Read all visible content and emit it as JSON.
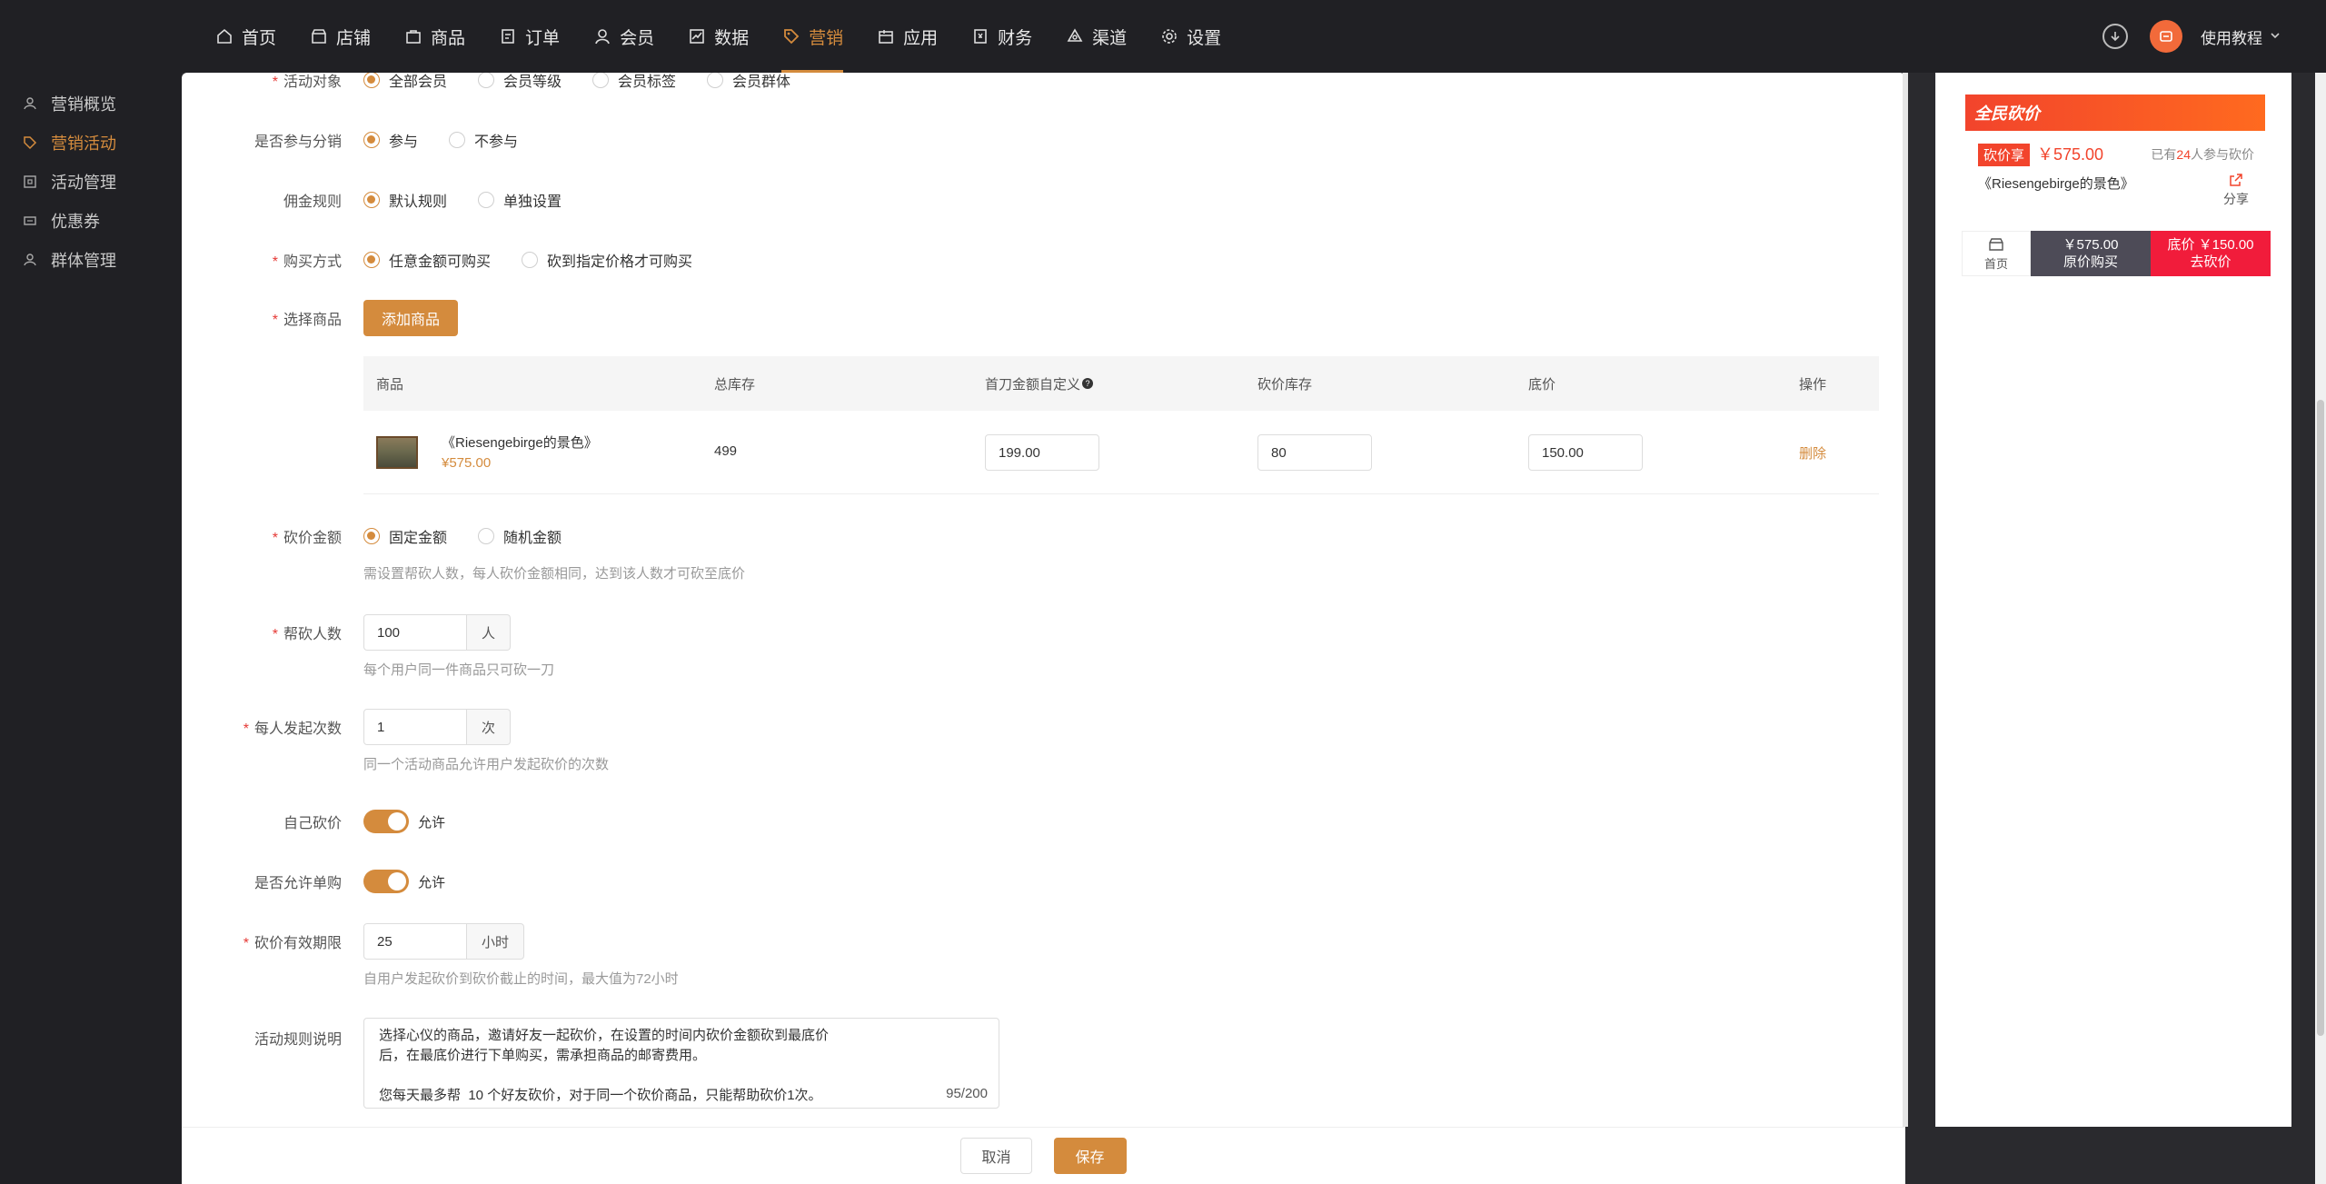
{
  "nav": {
    "items": [
      {
        "label": "首页",
        "icon": "home-icon"
      },
      {
        "label": "店铺",
        "icon": "store-icon"
      },
      {
        "label": "商品",
        "icon": "bag-icon"
      },
      {
        "label": "订单",
        "icon": "order-icon"
      },
      {
        "label": "会员",
        "icon": "user-icon"
      },
      {
        "label": "数据",
        "icon": "chart-icon"
      },
      {
        "label": "营销",
        "icon": "tag-icon"
      },
      {
        "label": "应用",
        "icon": "app-icon"
      },
      {
        "label": "财务",
        "icon": "finance-icon"
      },
      {
        "label": "渠道",
        "icon": "channel-icon"
      },
      {
        "label": "设置",
        "icon": "gear-icon"
      }
    ],
    "active": "营销",
    "help_label": "使用教程"
  },
  "sidebar": {
    "items": [
      {
        "label": "营销概览"
      },
      {
        "label": "营销活动"
      },
      {
        "label": "活动管理"
      },
      {
        "label": "优惠券"
      },
      {
        "label": "群体管理"
      }
    ],
    "active": "营销活动"
  },
  "form": {
    "target": {
      "label": "活动对象",
      "options": [
        "全部会员",
        "会员等级",
        "会员标签",
        "会员群体"
      ]
    },
    "distribution": {
      "label": "是否参与分销",
      "options": [
        "参与",
        "不参与"
      ],
      "selected": "参与"
    },
    "commission": {
      "label": "佣金规则",
      "options": [
        "默认规则",
        "单独设置"
      ],
      "selected": "默认规则"
    },
    "buy_mode": {
      "label": "购买方式",
      "options": [
        "任意金额可购买",
        "砍到指定价格才可购买"
      ],
      "selected": "任意金额可购买"
    },
    "product": {
      "label": "选择商品",
      "add_button": "添加商品"
    },
    "table": {
      "headers": [
        "商品",
        "总库存",
        "首刀金额自定义",
        "砍价库存",
        "底价",
        "操作"
      ],
      "rows": [
        {
          "name": "《Riesengebirge的景色》",
          "price": "¥575.00",
          "stock": "499",
          "first_cut": "199.00",
          "cut_stock": "80",
          "floor": "150.00",
          "action": "删除"
        }
      ]
    },
    "cut_amount": {
      "label": "砍价金额",
      "options": [
        "固定金额",
        "随机金额"
      ],
      "selected": "固定金额",
      "hint": "需设置帮砍人数，每人砍价金额相同，达到该人数才可砍至底价"
    },
    "helpers": {
      "label": "帮砍人数",
      "value": "100",
      "unit": "人",
      "hint": "每个用户同一件商品只可砍一刀"
    },
    "launch_times": {
      "label": "每人发起次数",
      "value": "1",
      "unit": "次",
      "hint": "同一个活动商品允许用户发起砍价的次数"
    },
    "self_cut": {
      "label": "自己砍价",
      "state": "允许"
    },
    "single_buy": {
      "label": "是否允许单购",
      "state": "允许"
    },
    "validity": {
      "label": "砍价有效期限",
      "value": "25",
      "unit": "小时",
      "hint": "自用户发起砍价到砍价截止的时间，最大值为72小时"
    },
    "rules": {
      "label": "活动规则说明",
      "line1": "选择心仪的商品，邀请好友一起砍价，在设置的时间内砍价金额砍到最底价",
      "line2": "后，在最底价进行下单购买，需承担商品的邮寄费用。",
      "line3": "",
      "line4": "您每天最多帮  10 个好友砍价，对于同一个砍价商品，只能帮助砍价1次。",
      "counter": "95/200"
    }
  },
  "footer": {
    "cancel": "取消",
    "save": "保存"
  },
  "preview": {
    "banner": "全民砍价",
    "tag": "砍价享",
    "price": "￥575.00",
    "participants_prefix": "已有",
    "participants_count": "24",
    "participants_suffix": "人参与砍价",
    "title": "《Riesengebirge的景色》",
    "share": "分享",
    "home": "首页",
    "buy_price": "￥575.00",
    "buy_label": "原价购买",
    "cut_price": "底价 ￥150.00",
    "cut_label": "去砍价"
  },
  "colors": {
    "accent": "#d48b3d",
    "nav_bg": "#202024",
    "promo_red": "#f2442c"
  }
}
